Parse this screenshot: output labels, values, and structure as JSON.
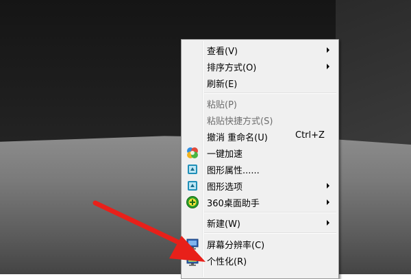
{
  "context_menu": {
    "items": [
      {
        "label": "查看(V)",
        "submenu": true
      },
      {
        "label": "排序方式(O)",
        "submenu": true
      },
      {
        "label": "刷新(E)"
      },
      {
        "label": "粘贴(P)",
        "disabled": true
      },
      {
        "label": "粘贴快捷方式(S)",
        "disabled": true
      },
      {
        "label": "撤消 重命名(U)",
        "shortcut": "Ctrl+Z"
      },
      {
        "label": "一键加速",
        "icon": "speedup-icon"
      },
      {
        "label": "图形属性......",
        "icon": "graphics-properties-icon"
      },
      {
        "label": "图形选项",
        "icon": "graphics-options-icon",
        "submenu": true
      },
      {
        "label": "360桌面助手",
        "icon": "desktop-assistant-icon",
        "submenu": true
      },
      {
        "label": "新建(W)",
        "submenu": true
      },
      {
        "label": "屏幕分辨率(C)",
        "icon": "screen-resolution-icon"
      },
      {
        "label": "个性化(R)",
        "icon": "personalize-icon"
      }
    ]
  },
  "annotation": {
    "arrow_color": "#e8201a"
  }
}
